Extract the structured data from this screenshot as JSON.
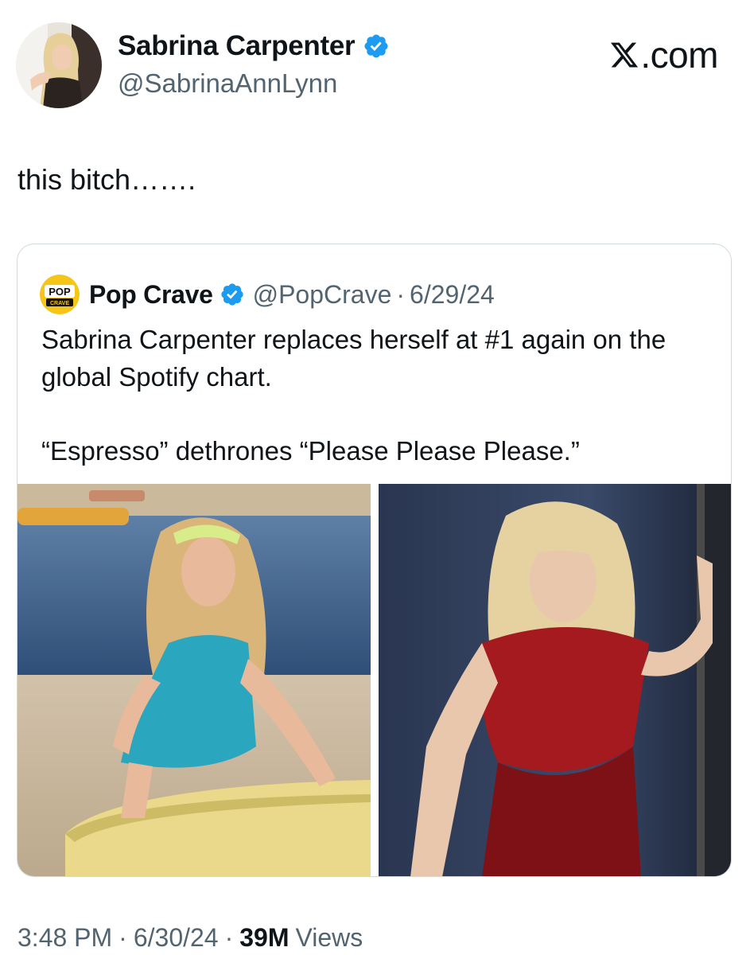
{
  "tweet": {
    "author": {
      "name": "Sabrina Carpenter",
      "handle": "@SabrinaAnnLynn",
      "verified": true
    },
    "source_label": ".com",
    "text": "this bitch…….",
    "timestamp": {
      "time": "3:48 PM",
      "separator": "·",
      "date": "6/30/24",
      "views_count": "39M",
      "views_label": "Views"
    }
  },
  "quoted_tweet": {
    "author": {
      "name": "Pop Crave",
      "handle": "@PopCrave",
      "verified": true,
      "avatar_text_top": "POP",
      "avatar_text_bottom": "CRAVE"
    },
    "separator": "·",
    "date": "6/29/24",
    "paragraphs": [
      "Sabrina Carpenter replaces herself at #1 again on the global Spotify chart.",
      "“Espresso” dethrones “Please Please Please.”"
    ],
    "media": [
      {
        "description_icon": "photo-beach"
      },
      {
        "description_icon": "photo-red-dress"
      }
    ]
  },
  "colors": {
    "text_primary": "#0f1419",
    "text_secondary": "#536471",
    "verified_blue": "#1d9bf0",
    "card_border": "#cfd9de",
    "pop_crave_yellow": "#f5c518"
  }
}
